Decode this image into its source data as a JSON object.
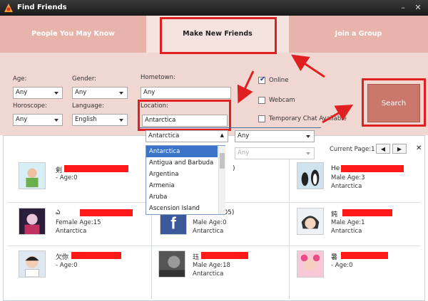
{
  "window": {
    "title": "Find Friends",
    "minimize": "–",
    "close": "✕"
  },
  "tabs": [
    {
      "label": "People You May Know"
    },
    {
      "label": "Make New Friends"
    },
    {
      "label": "Join a Group"
    }
  ],
  "filters": {
    "age_label": "Age:",
    "age_value": "Any",
    "gender_label": "Gender:",
    "gender_value": "Any",
    "hometown_label": "Hometown:",
    "hometown_value": "Any",
    "horoscope_label": "Horoscope:",
    "horoscope_value": "Any",
    "language_label": "Language:",
    "language_value": "English",
    "location_label": "Location:",
    "location_value": "Antarctica",
    "country_select": "Antarctica",
    "region_select": "Any",
    "city_select": "Any"
  },
  "options": {
    "online_label": "Online",
    "online_checked": "✔",
    "webcam_label": "Webcam",
    "temp_chat_label": "Temporary Chat Available"
  },
  "search_label": "Search",
  "country_options": [
    "Antarctica",
    "Antigua and Barbuda",
    "Argentina",
    "Armenia",
    "Aruba",
    "Ascension Island"
  ],
  "pager": {
    "label": "Current Page:1",
    "prev": "◀",
    "next": "▶",
    "close": "✕"
  },
  "results": [
    {
      "name": "剣",
      "line1": "- Age:0",
      "line2": ""
    },
    {
      "name": "",
      "line1": "",
      "line2": ""
    },
    {
      "name": "He",
      "line1": "Male Age:3",
      "line2": "Antarctica"
    },
    {
      "name": "ఎ",
      "line1": "Female Age:15",
      "line2": "Antarctica"
    },
    {
      "name": "",
      "line1": "Male Age:0",
      "line2": "Antarctica"
    },
    {
      "name": "鈍",
      "line1": "Male Age:1",
      "line2": "Antarctica"
    },
    {
      "name": "欠你",
      "line1": "- Age:0",
      "line2": ""
    },
    {
      "name": "珏",
      "line1": "Male Age:18",
      "line2": "Antarctica"
    },
    {
      "name": "暑",
      "line1": "- Age:0",
      "line2": ""
    }
  ],
  "partial_text": {
    "r2": ")",
    "r5": "9905)"
  },
  "colors": {
    "tab_bar": "#e7b3ab",
    "panel": "#f0d7d1",
    "search_button": "#c9786b",
    "highlight": "#e02020",
    "selection": "#3b73c9"
  }
}
